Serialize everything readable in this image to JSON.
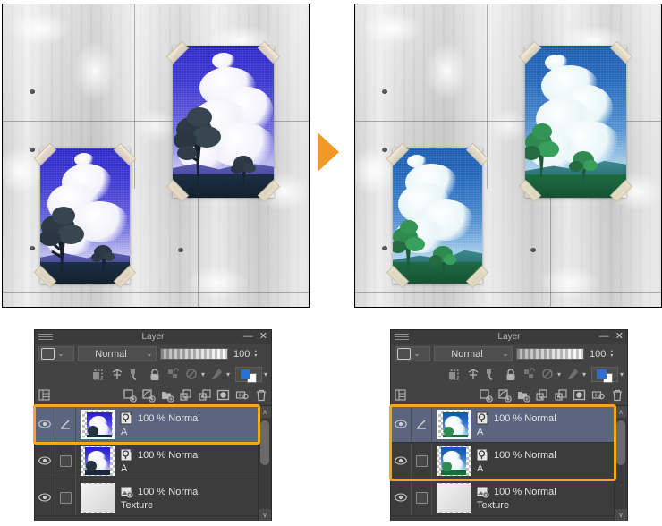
{
  "illustration": {
    "left_canvas": {
      "name": "before-canvas",
      "description": "Concrete wall with two taped landscape posters in blue/violet tones",
      "posters": [
        {
          "id": "poster-large",
          "palette": "blue-violet"
        },
        {
          "id": "poster-small",
          "palette": "blue-violet"
        }
      ]
    },
    "arrow": {
      "name": "step-arrow",
      "color": "#f09a25",
      "direction": "right"
    },
    "right_canvas": {
      "name": "after-canvas",
      "description": "Same wall with posters recolored to blue/green tones",
      "posters": [
        {
          "id": "poster-large",
          "palette": "blue-green"
        },
        {
          "id": "poster-small",
          "palette": "blue-green"
        }
      ]
    }
  },
  "palette_left": {
    "title": "Layer",
    "menu_icon": "hamburger-icon",
    "minimize": "—",
    "close": "✕",
    "mask_combo": {
      "icon": "layer-mask-icon",
      "arrow": "⌄"
    },
    "blend_mode": {
      "value": "Normal",
      "arrow": "⌄"
    },
    "opacity": {
      "value": "100",
      "spinner_up": "▴",
      "spinner_down": "▾"
    },
    "tool_icons_row1": [
      "clip-to-layer-icon",
      "mask-enable-icon",
      "ruler-snap-icon",
      "lock-icon",
      "lock-transparent-icon",
      "select-layer-icon",
      "select-layer-chevron",
      "draw-restrict-icon",
      "draw-restrict-chevron",
      "fgbg-color-icon",
      "fgbg-chevron"
    ],
    "tool_icons_row2": [
      "layer-palette-list-icon",
      "new-raster-layer-icon",
      "new-vector-layer-icon",
      "new-folder-icon",
      "transfer-down-icon",
      "combine-down-icon",
      "layer-mask-create-icon",
      "layer-property-icon",
      "delete-layer-icon"
    ],
    "layers": [
      {
        "visible": true,
        "checked": false,
        "selected": true,
        "kind_icon": "raster-layer-icon",
        "opacity": "100 %",
        "blend": "Normal",
        "name": "A",
        "thumb": "poster-blue",
        "edit_icon": "pencil-edit-icon"
      },
      {
        "visible": true,
        "checked": false,
        "selected": false,
        "kind_icon": "raster-layer-icon",
        "opacity": "100 %",
        "blend": "Normal",
        "name": "A",
        "thumb": "poster-blue",
        "edit_icon": ""
      },
      {
        "visible": true,
        "checked": false,
        "selected": false,
        "kind_icon": "texture-layer-icon",
        "opacity": "100 %",
        "blend": "Normal",
        "name": "Texture",
        "thumb": "texture-gray",
        "edit_icon": ""
      }
    ],
    "scrollbar": {
      "up": "∧",
      "down": "∨"
    },
    "highlight": {
      "color": "#f5a623",
      "covers_rows": [
        0
      ]
    }
  },
  "palette_right": {
    "title": "Layer",
    "menu_icon": "hamburger-icon",
    "minimize": "—",
    "close": "✕",
    "mask_combo": {
      "icon": "layer-mask-icon",
      "arrow": "⌄"
    },
    "blend_mode": {
      "value": "Normal",
      "arrow": "⌄"
    },
    "opacity": {
      "value": "100",
      "spinner_up": "▴",
      "spinner_down": "▾"
    },
    "tool_icons_row1": [
      "clip-to-layer-icon",
      "mask-enable-icon",
      "ruler-snap-icon",
      "lock-icon",
      "lock-transparent-icon",
      "select-layer-icon",
      "select-layer-chevron",
      "draw-restrict-icon",
      "draw-restrict-chevron",
      "fgbg-color-icon",
      "fgbg-chevron"
    ],
    "tool_icons_row2": [
      "layer-palette-list-icon",
      "new-raster-layer-icon",
      "new-vector-layer-icon",
      "new-folder-icon",
      "transfer-down-icon",
      "combine-down-icon",
      "layer-mask-create-icon",
      "layer-property-icon",
      "delete-layer-icon"
    ],
    "layers": [
      {
        "visible": true,
        "checked": false,
        "selected": true,
        "kind_icon": "raster-layer-icon",
        "opacity": "100 %",
        "blend": "Normal",
        "name": "A",
        "thumb": "poster-green",
        "edit_icon": "pencil-edit-icon"
      },
      {
        "visible": true,
        "checked": false,
        "selected": false,
        "kind_icon": "raster-layer-icon",
        "opacity": "100 %",
        "blend": "Normal",
        "name": "A",
        "thumb": "poster-green",
        "edit_icon": ""
      },
      {
        "visible": true,
        "checked": false,
        "selected": false,
        "kind_icon": "texture-layer-icon",
        "opacity": "100 %",
        "blend": "Normal",
        "name": "Texture",
        "thumb": "texture-gray",
        "edit_icon": ""
      }
    ],
    "scrollbar": {
      "up": "∧",
      "down": "∨"
    },
    "highlight": {
      "color": "#f5a623",
      "covers_rows": [
        0,
        1
      ]
    }
  },
  "colors": {
    "panel_bg": "#434343",
    "list_bg": "#3c3c3c",
    "selected_row": "#5c6580",
    "highlight": "#f5a623",
    "arrow": "#f09a25",
    "text": "#e2e2e2"
  }
}
